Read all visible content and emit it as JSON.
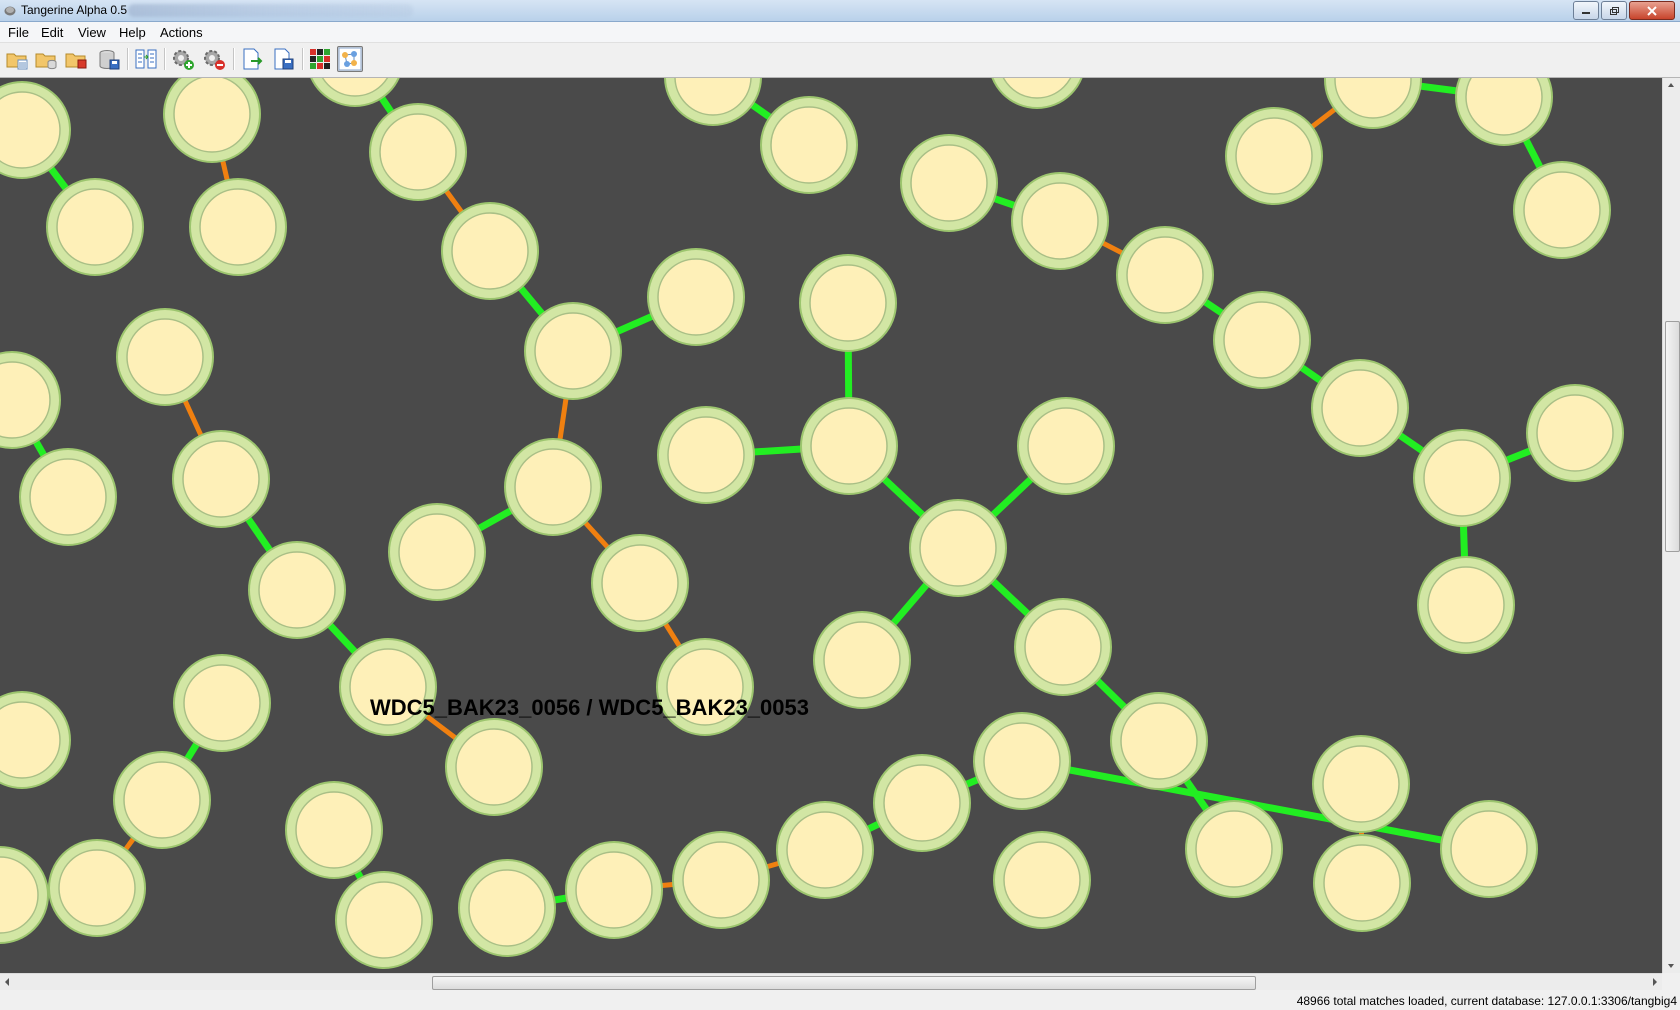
{
  "window": {
    "title": "Tangerine Alpha 0.5",
    "controls": [
      "minimize",
      "maximize",
      "close"
    ]
  },
  "menu": [
    "File",
    "Edit",
    "View",
    "Help",
    "Actions"
  ],
  "toolbar": {
    "buttons": [
      {
        "icon": "open-folder-icon"
      },
      {
        "icon": "open-folder-database-icon"
      },
      {
        "icon": "open-folder-remove-icon"
      },
      {
        "icon": "database-save-icon"
      },
      {
        "icon": "compare-columns-icon"
      },
      {
        "icon": "gear-add-icon"
      },
      {
        "icon": "gear-remove-icon"
      },
      {
        "icon": "export-document-icon"
      },
      {
        "icon": "save-document-icon"
      },
      {
        "icon": "heatmap-view-icon"
      },
      {
        "icon": "graph-view-icon",
        "active": true
      }
    ]
  },
  "graph": {
    "background": "#4a4a4a",
    "node_fill": "#fef0b8",
    "node_ring": "#d2e6a4",
    "edge_colors": {
      "green": "#22ee22",
      "orange": "#f08010"
    },
    "hover_label": "WDC5_BAK23_0056 / WDC5_BAK23_0053"
  },
  "status": {
    "text": "48966 total matches loaded, current database: 127.0.0.1:3306/tangbig4"
  }
}
